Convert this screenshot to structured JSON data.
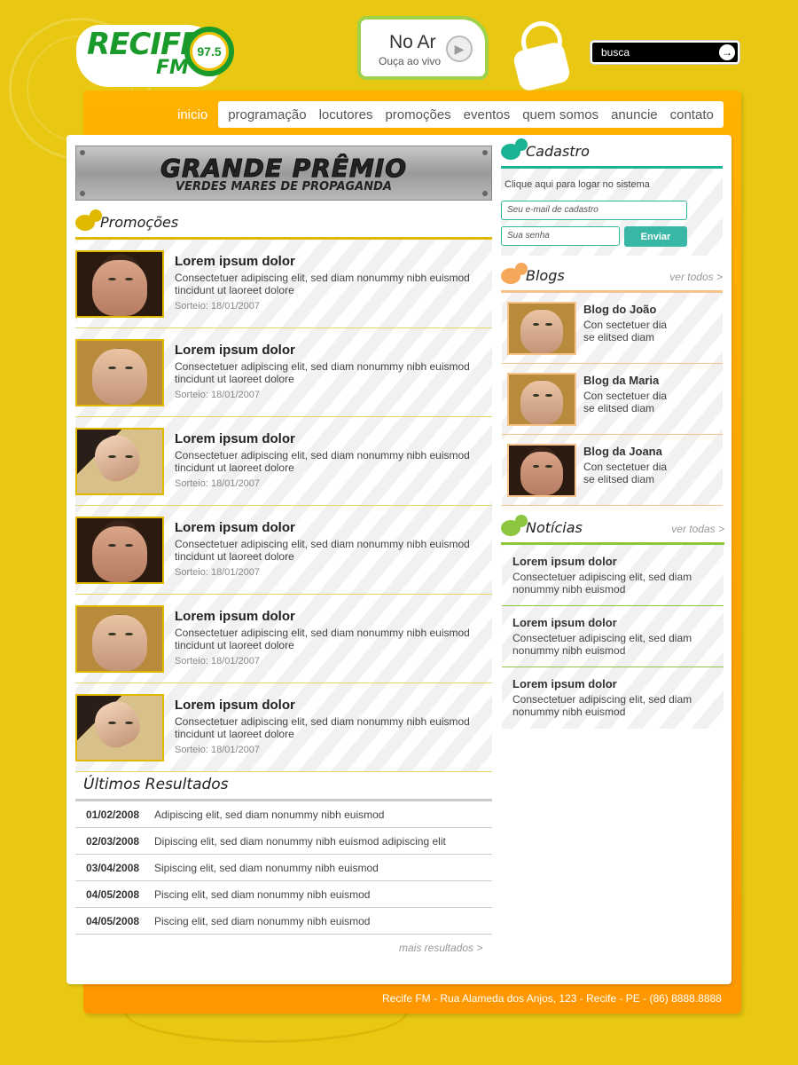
{
  "header": {
    "logo_text": "RECIFE",
    "logo_fm": "FM",
    "logo_freq": "97.5",
    "onair_title": "No Ar",
    "onair_sub": "Ouça ao vivo",
    "search_label": "busca"
  },
  "nav": {
    "active": "inicio",
    "items": [
      "programação",
      "locutores",
      "promoções",
      "eventos",
      "quem somos",
      "anuncie",
      "contato"
    ]
  },
  "banner": {
    "line1": "GRANDE PRÊMIO",
    "line2": "VERDES MARES DE PROPAGANDA"
  },
  "promocoes": {
    "title": "Promoções",
    "items": [
      {
        "title": "Lorem ipsum dolor",
        "desc": "Consectetuer adipiscing elit, sed diam nonummy nibh euismod tincidunt ut laoreet dolore",
        "date": "Sorteio: 18/01/2007",
        "face": "dark"
      },
      {
        "title": "Lorem ipsum dolor",
        "desc": "Consectetuer adipiscing elit, sed diam nonummy nibh euismod tincidunt ut laoreet dolore",
        "date": "Sorteio: 18/01/2007",
        "face": "blond"
      },
      {
        "title": "Lorem ipsum dolor",
        "desc": "Consectetuer adipiscing elit, sed diam nonummy nibh euismod tincidunt ut laoreet dolore",
        "date": "Sorteio: 18/01/2007",
        "face": "tilt"
      },
      {
        "title": "Lorem ipsum dolor",
        "desc": "Consectetuer adipiscing elit, sed diam nonummy nibh euismod tincidunt ut laoreet dolore",
        "date": "Sorteio: 18/01/2007",
        "face": "dark"
      },
      {
        "title": "Lorem ipsum dolor",
        "desc": "Consectetuer adipiscing elit, sed diam nonummy nibh euismod tincidunt ut laoreet dolore",
        "date": "Sorteio: 18/01/2007",
        "face": "blond"
      },
      {
        "title": "Lorem ipsum dolor",
        "desc": "Consectetuer adipiscing elit, sed diam nonummy nibh euismod tincidunt ut laoreet dolore",
        "date": "Sorteio: 18/01/2007",
        "face": "tilt"
      }
    ]
  },
  "resultados": {
    "title": "Últimos Resultados",
    "rows": [
      {
        "date": "01/02/2008",
        "text": "Adipiscing elit, sed diam nonummy nibh euismod"
      },
      {
        "date": "02/03/2008",
        "text": "Dipiscing elit, sed diam nonummy nibh euismod adipiscing elit"
      },
      {
        "date": "03/04/2008",
        "text": "Sipiscing elit, sed diam nonummy nibh euismod"
      },
      {
        "date": "04/05/2008",
        "text": "Piscing elit, sed diam nonummy nibh euismod"
      },
      {
        "date": "04/05/2008",
        "text": "Piscing elit, sed diam nonummy nibh euismod"
      }
    ],
    "more": "mais resultados >"
  },
  "cadastro": {
    "title": "Cadastro",
    "text": "Clique aqui para logar no sistema",
    "email_placeholder": "Seu e-mail de cadastro",
    "password_placeholder": "Sua senha",
    "submit": "Enviar"
  },
  "blogs": {
    "title": "Blogs",
    "more": "ver todos >",
    "items": [
      {
        "title": "Blog do João",
        "desc": "Con sectetuer dia se elitsed diam",
        "face": "blond"
      },
      {
        "title": "Blog da Maria",
        "desc": "Con sectetuer dia se elitsed diam",
        "face": "blond"
      },
      {
        "title": "Blog da Joana",
        "desc": "Con sectetuer dia se elitsed diam",
        "face": "dark"
      }
    ]
  },
  "noticias": {
    "title": "Notícias",
    "more": "ver todas >",
    "items": [
      {
        "title": "Lorem ipsum dolor",
        "desc": "Consectetuer adipiscing elit, sed diam nonummy nibh euismod"
      },
      {
        "title": "Lorem ipsum dolor",
        "desc": "Consectetuer adipiscing elit, sed diam nonummy nibh euismod"
      },
      {
        "title": "Lorem ipsum dolor",
        "desc": "Consectetuer adipiscing elit, sed diam nonummy nibh euismod"
      }
    ]
  },
  "footer": {
    "text": "Recife FM - Rua Alameda dos Anjos, 123 - Recife - PE - (86) 8888.8888"
  },
  "colors": {
    "background": "#e8c812",
    "frame": "#ffa200",
    "cadastro_accent": "#1ab394",
    "blogs_accent": "#f6a85a",
    "noticias_accent": "#8cc63f",
    "promo_accent": "#e0b800"
  }
}
